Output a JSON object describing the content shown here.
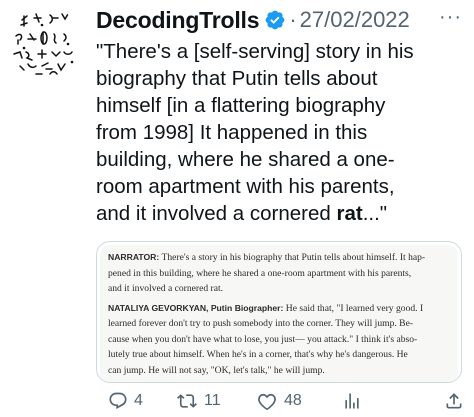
{
  "tweet": {
    "display_name": "DecodingTrolls",
    "separator": "·",
    "date": "27/02/2022",
    "more_label": "···",
    "text_lines": [
      "\"There's a [self-serving] story in his",
      "biography that Putin tells about",
      "himself [in a flattering biography",
      "from 1998] It happened in this",
      "building, where he shared a one-",
      "room apartment with his parents,"
    ],
    "last_line_prefix": "and it involved a cornered ",
    "last_line_bold": "rat",
    "last_line_suffix": "...\""
  },
  "media": {
    "speaker1": "NARRATOR:",
    "speaker1_lines": [
      "There's a story in his biography that Putin tells about himself. It hap-",
      "pened in this building, where he shared a one-room apartment with his parents,",
      "and it involved a cornered rat."
    ],
    "speaker2": "NATALIYA GEVORKYAN, Putin Biographer:",
    "speaker2_first": "He said that, \"I learned very good. I",
    "speaker2_lines": [
      "learned forever don't try to push somebody into the corner. They will jump. Be-",
      "cause when you don't have what to lose, you just— you attack.\" I think it's abso-",
      "lutely true about himself. When he's in a corner, that's why he's dangerous. He",
      "can jump. He will not say, \"OK, let's talk,\" he will jump."
    ]
  },
  "actions": {
    "replies": "4",
    "retweets": "11",
    "likes": "48"
  },
  "icons": {
    "avatar": "glyph-pattern-avatar",
    "verified": "verified-badge-icon",
    "reply": "reply-icon",
    "retweet": "retweet-icon",
    "like": "heart-icon",
    "views": "analytics-icon",
    "share": "share-icon"
  },
  "colors": {
    "verified": "#1d9bf0",
    "muted": "#536471",
    "text": "#0f1419"
  }
}
